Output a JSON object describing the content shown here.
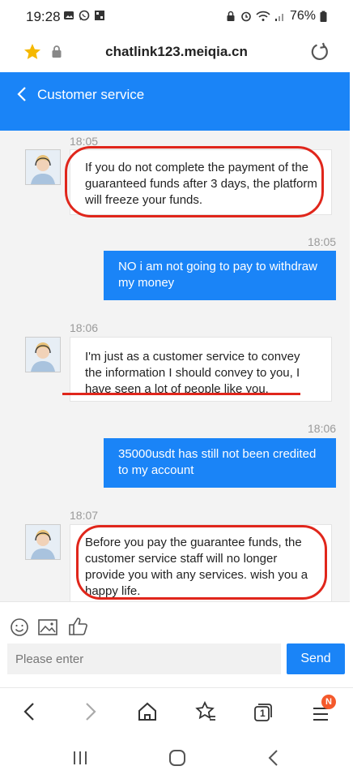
{
  "status_bar": {
    "time": "19:28",
    "battery": "76%",
    "left_icons": [
      "image-icon",
      "whatsapp-icon",
      "grid-app-icon"
    ],
    "right_icons": [
      "lock-icon",
      "alarm-icon",
      "wifi-icon",
      "signal-icon",
      "battery-icon"
    ]
  },
  "browser": {
    "url": "chatlink123.meiqia.cn",
    "icons": [
      "star-icon",
      "lock-icon",
      "reload-icon"
    ]
  },
  "header": {
    "title": "Customer service",
    "back_icon": "chevron-left-icon"
  },
  "messages": [
    {
      "side": "in",
      "time": "18:05",
      "text": "If you do not complete the payment of the guaranteed funds after 3 days, the platform will freeze your funds."
    },
    {
      "side": "out",
      "time": "18:05",
      "text": "NO i am not going to pay to withdraw my money"
    },
    {
      "side": "in",
      "time": "18:06",
      "text": "I'm just as a customer service to convey the information I should convey to you, I have seen a lot of people like you."
    },
    {
      "side": "out",
      "time": "18:06",
      "text": "35000usdt has still not been credited to my account"
    },
    {
      "side": "in",
      "time": "18:07",
      "text": "Before you pay the guarantee funds, the customer service staff will no longer provide you with any services. wish you a happy life."
    }
  ],
  "composer": {
    "placeholder": "Please enter",
    "send_label": "Send",
    "tool_icons": [
      "emoji-icon",
      "image-icon",
      "thumbs-up-icon"
    ]
  },
  "browser_nav": {
    "tabs_count": "1",
    "badge": "N",
    "icons": [
      "back-icon",
      "forward-icon",
      "home-icon",
      "bookmarks-icon",
      "tabs-icon",
      "menu-icon"
    ]
  },
  "system_nav": {
    "icons": [
      "recents-icon",
      "home-circle-icon",
      "back-icon"
    ]
  },
  "colors": {
    "accent": "#1a84f7",
    "annotation_red": "#e0261b",
    "chat_bg": "#f3f3f3",
    "badge": "#f4592b"
  }
}
